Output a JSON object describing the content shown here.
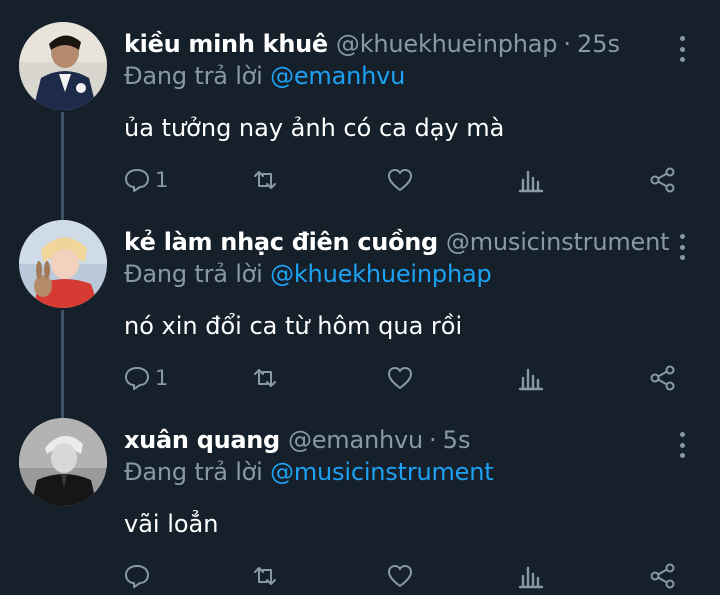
{
  "tweets": [
    {
      "name": "kiều minh khuê",
      "handle": "@khuekhueinphap",
      "separator": "·",
      "time": "25s",
      "replying_prefix": "Đang trả lời",
      "replying_to": "@emanhvu",
      "text": "ủa tưởng nay ảnh có ca dạy mà",
      "reply_count": "1"
    },
    {
      "name": "kẻ làm nhạc điên cuồng",
      "handle": "@musicinstrument",
      "ellipsis": "...",
      "replying_prefix": "Đang trả lời",
      "replying_to": "@khuekhueinphap",
      "text": "nó xin đổi ca từ hôm qua rồi",
      "reply_count": "1"
    },
    {
      "name": "xuân quang",
      "handle": "@emanhvu",
      "separator": "·",
      "time": "5s",
      "replying_prefix": "Đang trả lời",
      "replying_to": "@musicinstrument",
      "text": "vãi loẳn",
      "reply_count": ""
    }
  ],
  "colors": {
    "background": "#15202b",
    "secondary_text": "#8899a6",
    "accent": "#1da1f2",
    "thread_line": "#3d5466"
  },
  "icons": [
    "reply-icon",
    "retweet-icon",
    "like-icon",
    "analytics-icon",
    "share-icon",
    "more-icon"
  ]
}
